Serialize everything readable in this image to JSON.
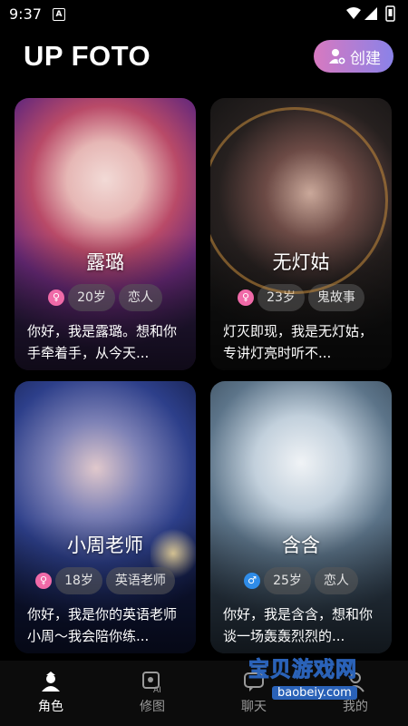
{
  "status_bar": {
    "time": "9:37",
    "notification": "A"
  },
  "header": {
    "title": "UP FOTO",
    "create_label": "创建"
  },
  "cards": [
    {
      "name": "露璐",
      "gender": "female",
      "age": "20岁",
      "tag": "恋人",
      "desc": "你好，我是露璐。想和你手牵着手，从今天..."
    },
    {
      "name": "无灯姑",
      "gender": "female",
      "age": "23岁",
      "tag": "鬼故事",
      "desc": "灯灭即现，我是无灯姑，专讲灯亮时听不..."
    },
    {
      "name": "小周老师",
      "gender": "female",
      "age": "18岁",
      "tag": "英语老师",
      "desc": "你好，我是你的英语老师小周～我会陪你练..."
    },
    {
      "name": "含含",
      "gender": "male",
      "age": "25岁",
      "tag": "恋人",
      "desc": "你好，我是含含，想和你谈一场轰轰烈烈的..."
    }
  ],
  "bottom_nav": [
    {
      "label": "角色",
      "icon": "character-icon",
      "active": true
    },
    {
      "label": "修图",
      "icon": "ai-edit-icon",
      "active": false
    },
    {
      "label": "聊天",
      "icon": "chat-icon",
      "active": false
    },
    {
      "label": "我的",
      "icon": "profile-icon",
      "active": false
    }
  ],
  "watermark": {
    "text": "宝贝游戏网",
    "url": "baobeiy.com"
  },
  "colors": {
    "background": "#000000",
    "create_gradient_start": "#d879c0",
    "create_gradient_end": "#8a82e8",
    "female": "#f06aa8",
    "male": "#2f8ce8"
  }
}
